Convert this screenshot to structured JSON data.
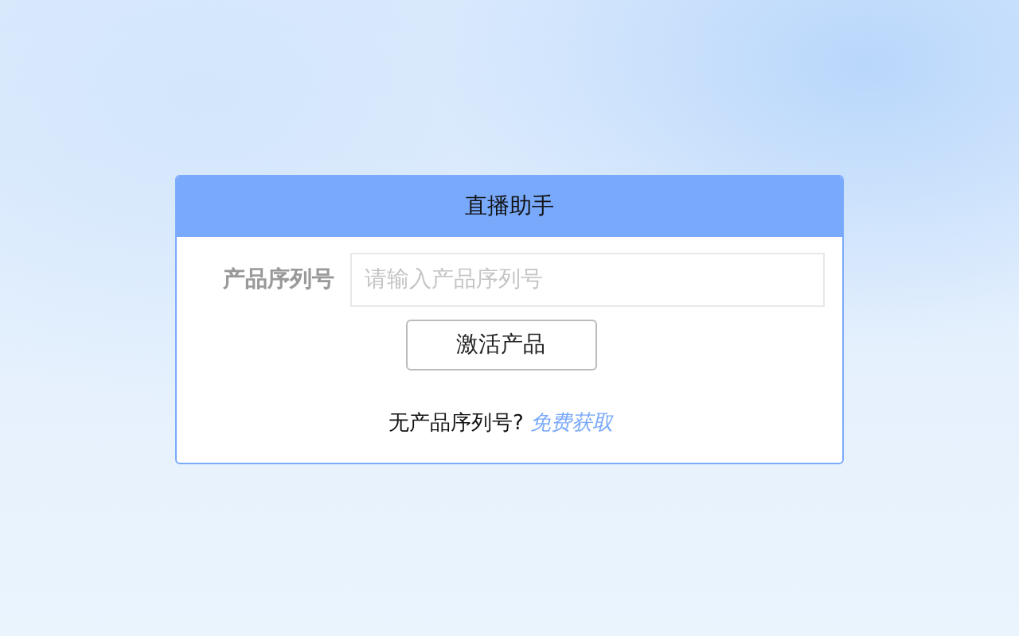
{
  "dialog": {
    "title": "直播助手",
    "field": {
      "label": "产品序列号",
      "placeholder": "请输入产品序列号"
    },
    "button": "激活产品",
    "footer": {
      "text": "无产品序列号?",
      "link": "免费获取"
    }
  }
}
